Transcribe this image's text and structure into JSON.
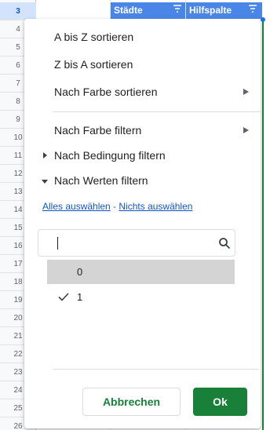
{
  "sheet": {
    "row_numbers": [
      "3",
      "4",
      "5",
      "6",
      "7",
      "8",
      "9",
      "10",
      "11",
      "12",
      "13",
      "14",
      "15",
      "16",
      "17",
      "18",
      "19",
      "20",
      "21",
      "22",
      "23",
      "24",
      "25",
      "26"
    ],
    "headers": [
      "Städte",
      "Hilfspalte"
    ],
    "header_color": "#4a86e8"
  },
  "menu": {
    "sort_az": "A bis Z sortieren",
    "sort_za": "Z bis A sortieren",
    "sort_color": "Nach Farbe sortieren",
    "filter_color": "Nach Farbe filtern",
    "filter_condition": "Nach Bedingung filtern",
    "filter_values": "Nach Werten filtern"
  },
  "values": {
    "select_all": "Alles auswählen",
    "separator": " - ",
    "select_none": "Nichts auswählen",
    "search_value": "",
    "items": [
      {
        "label": "0",
        "checked": false
      },
      {
        "label": "1",
        "checked": true
      }
    ]
  },
  "buttons": {
    "cancel": "Abbrechen",
    "ok": "Ok",
    "ok_color": "#188038"
  }
}
